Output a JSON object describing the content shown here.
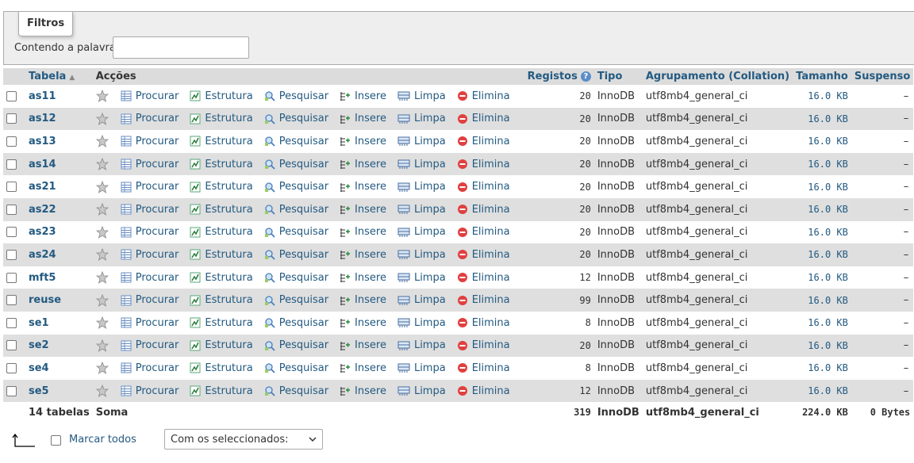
{
  "filters": {
    "legend": "Filtros",
    "label": "Contendo a palavra:",
    "value": ""
  },
  "table": {
    "headers": {
      "tabela": "Tabela",
      "accoes": "Acções",
      "registos": "Registos",
      "tipo": "Tipo",
      "agrupamento": "Agrupamento (Collation)",
      "tamanho": "Tamanho",
      "suspenso": "Suspenso"
    },
    "actions": {
      "procurar": "Procurar",
      "estrutura": "Estrutura",
      "pesquisar": "Pesquisar",
      "insere": "Insere",
      "limpa": "Limpa",
      "elimina": "Elimina"
    },
    "rows": [
      {
        "name": "as11",
        "rows": "20",
        "type": "InnoDB",
        "collation": "utf8mb4_general_ci",
        "size": "16.0 KB",
        "overhead": "–"
      },
      {
        "name": "as12",
        "rows": "20",
        "type": "InnoDB",
        "collation": "utf8mb4_general_ci",
        "size": "16.0 KB",
        "overhead": "–"
      },
      {
        "name": "as13",
        "rows": "20",
        "type": "InnoDB",
        "collation": "utf8mb4_general_ci",
        "size": "16.0 KB",
        "overhead": "–"
      },
      {
        "name": "as14",
        "rows": "20",
        "type": "InnoDB",
        "collation": "utf8mb4_general_ci",
        "size": "16.0 KB",
        "overhead": "–"
      },
      {
        "name": "as21",
        "rows": "20",
        "type": "InnoDB",
        "collation": "utf8mb4_general_ci",
        "size": "16.0 KB",
        "overhead": "–"
      },
      {
        "name": "as22",
        "rows": "20",
        "type": "InnoDB",
        "collation": "utf8mb4_general_ci",
        "size": "16.0 KB",
        "overhead": "–"
      },
      {
        "name": "as23",
        "rows": "20",
        "type": "InnoDB",
        "collation": "utf8mb4_general_ci",
        "size": "16.0 KB",
        "overhead": "–"
      },
      {
        "name": "as24",
        "rows": "20",
        "type": "InnoDB",
        "collation": "utf8mb4_general_ci",
        "size": "16.0 KB",
        "overhead": "–"
      },
      {
        "name": "mft5",
        "rows": "12",
        "type": "InnoDB",
        "collation": "utf8mb4_general_ci",
        "size": "16.0 KB",
        "overhead": "–"
      },
      {
        "name": "reuse",
        "rows": "99",
        "type": "InnoDB",
        "collation": "utf8mb4_general_ci",
        "size": "16.0 KB",
        "overhead": "–"
      },
      {
        "name": "se1",
        "rows": "8",
        "type": "InnoDB",
        "collation": "utf8mb4_general_ci",
        "size": "16.0 KB",
        "overhead": "–"
      },
      {
        "name": "se2",
        "rows": "20",
        "type": "InnoDB",
        "collation": "utf8mb4_general_ci",
        "size": "16.0 KB",
        "overhead": "–"
      },
      {
        "name": "se4",
        "rows": "8",
        "type": "InnoDB",
        "collation": "utf8mb4_general_ci",
        "size": "16.0 KB",
        "overhead": "–"
      },
      {
        "name": "se5",
        "rows": "12",
        "type": "InnoDB",
        "collation": "utf8mb4_general_ci",
        "size": "16.0 KB",
        "overhead": "–"
      }
    ],
    "footer": {
      "count": "14 tabelas",
      "label": "Soma",
      "rows": "319",
      "type": "InnoDB",
      "collation": "utf8mb4_general_ci",
      "size": "224.0 KB",
      "overhead": "0 Bytes"
    }
  },
  "bottom": {
    "mark_all": "Marcar todos",
    "with_selected": "Com os seleccionados:"
  },
  "icons": {
    "star": "star-icon",
    "browse": "browse-icon",
    "structure": "structure-icon",
    "search": "search-icon",
    "insert": "insert-icon",
    "empty": "empty-icon",
    "drop": "drop-icon"
  },
  "colors": {
    "link": "#235a81",
    "header_bg": "#dcdcdc",
    "row_alt": "#dfdfdf",
    "drop_red": "#e04040"
  }
}
